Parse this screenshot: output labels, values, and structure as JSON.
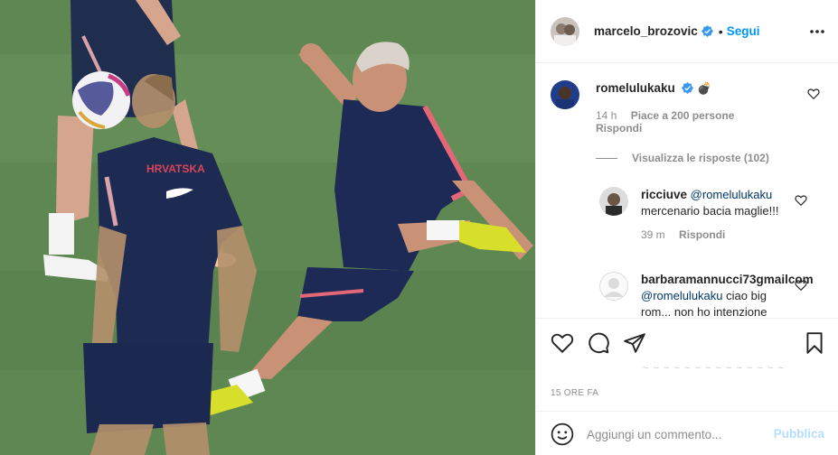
{
  "post": {
    "author": "marcelo_brozovic",
    "follow_label": "Segui",
    "separator": "•",
    "time_ago": "15 ORE FA",
    "faint_text": "~ ~ ~ ~ ~ ~ ~ ~ ~ ~ ~ ~ ~ ~"
  },
  "comments": [
    {
      "username": "romelulukaku",
      "emoji": "💣",
      "time": "14 h",
      "likes": "Piace a 200 persone",
      "reply_label": "Rispondi",
      "view_replies": "Visualizza le risposte (102)"
    },
    {
      "username": "ricciuve",
      "mention": "@romelulukaku",
      "text": "mercenario bacia maglie!!!",
      "time": "39 m",
      "reply_label": "Rispondi"
    },
    {
      "username": "barbaramannucci73gmailcom",
      "mention": "@romelulukaku",
      "text": "ciao big rom... non ho intenzione"
    }
  ],
  "add_comment": {
    "placeholder": "Aggiungi un commento...",
    "publish_label": "Pubblica"
  },
  "photo": {
    "jersey_text": "HRVATSKA"
  },
  "colors": {
    "accent": "#0095f6",
    "verified": "#3897f0",
    "publish_disabled": "#b2dffc",
    "muted": "#8e8e8e"
  },
  "icons": [
    "verified-icon",
    "more-icon",
    "heart-icon",
    "comment-icon",
    "share-icon",
    "bookmark-icon",
    "emoji-icon"
  ]
}
